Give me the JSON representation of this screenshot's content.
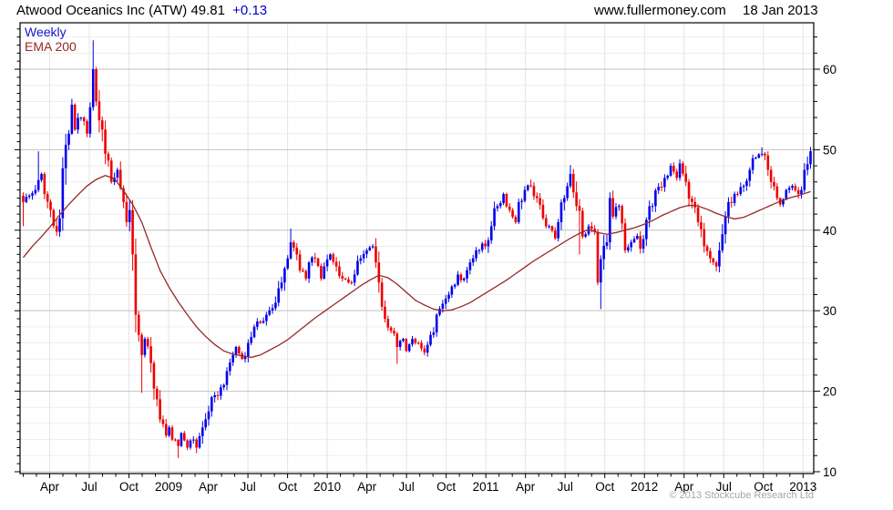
{
  "header": {
    "title": "Atwood Oceanics Inc (ATW)",
    "price": "49.81",
    "change": "+0.13",
    "site": "www.fullermoney.com",
    "date": "18 Jan 2013"
  },
  "legend": {
    "frequency": "Weekly",
    "overlay": "EMA 200"
  },
  "footer": {
    "copyright": "© 2013 Stockcube Research Ltd"
  },
  "colors": {
    "up": "#0000ee",
    "down": "#ee0000",
    "ema": "#962828",
    "accent_blue": "#0000cc",
    "legend_blue": "#1414cc",
    "grid_minor": "#ededed",
    "grid_major": "#c2c2c2",
    "grid_vertical": "#e4e4e4",
    "copyright_gray": "#a6a6a6",
    "axis": "#000000"
  },
  "chart_data": {
    "type": "candlestick",
    "title": "Atwood Oceanics Inc (ATW) weekly with 200 EMA",
    "frequency": "Weekly",
    "overlay": "EMA 200",
    "last_price": 49.81,
    "change": 0.13,
    "x_start": "2008-02",
    "x_end": "2013-01",
    "weeks": 260,
    "y_ticks": [
      10,
      20,
      30,
      40,
      50,
      60
    ],
    "y_minor_step": 2,
    "y_range": [
      9.77,
      65.77
    ],
    "x_tick_labels": [
      "Apr",
      "Jul",
      "Oct",
      "2009",
      "Apr",
      "Jul",
      "Oct",
      "2010",
      "Apr",
      "Jul",
      "Oct",
      "2011",
      "Apr",
      "Jul",
      "Oct",
      "2012",
      "Apr",
      "Jul",
      "Oct",
      "2013"
    ],
    "layout": {
      "l": 22,
      "t": 25,
      "r": 893,
      "b": 520
    },
    "close_anchors": [
      [
        0,
        43.5
      ],
      [
        2,
        44.3
      ],
      [
        4,
        45.0
      ],
      [
        6,
        47.0
      ],
      [
        7,
        44.5
      ],
      [
        9,
        42.5
      ],
      [
        11,
        39.8
      ],
      [
        12,
        41.5
      ],
      [
        13,
        47.7
      ],
      [
        15,
        52.0
      ],
      [
        16,
        55.6
      ],
      [
        17,
        52.5
      ],
      [
        19,
        54.0
      ],
      [
        21,
        52.0
      ],
      [
        23,
        60.0
      ],
      [
        24,
        56.0
      ],
      [
        26,
        52.5
      ],
      [
        27,
        49.5
      ],
      [
        29,
        46.0
      ],
      [
        31,
        47.5
      ],
      [
        33,
        43.5
      ],
      [
        34,
        41.0
      ],
      [
        35,
        42.5
      ],
      [
        36,
        37.0
      ],
      [
        37,
        29.5
      ],
      [
        38,
        27.0
      ],
      [
        39,
        24.5
      ],
      [
        40,
        26.5
      ],
      [
        42,
        23.5
      ],
      [
        44,
        19.0
      ],
      [
        45,
        16.5
      ],
      [
        47,
        14.5
      ],
      [
        48,
        15.5
      ],
      [
        49,
        14.0
      ],
      [
        51,
        13.2
      ],
      [
        52,
        14.8
      ],
      [
        54,
        13.0
      ],
      [
        56,
        14.0
      ],
      [
        57,
        13.0
      ],
      [
        59,
        15.5
      ],
      [
        61,
        17.5
      ],
      [
        63,
        19.5
      ],
      [
        65,
        20.5
      ],
      [
        67,
        22.5
      ],
      [
        69,
        24.5
      ],
      [
        70,
        25.5
      ],
      [
        72,
        24.0
      ],
      [
        74,
        26.0
      ],
      [
        76,
        28.0
      ],
      [
        78,
        28.5
      ],
      [
        80,
        29.5
      ],
      [
        83,
        31.0
      ],
      [
        85,
        33.5
      ],
      [
        87,
        36.5
      ],
      [
        88,
        38.5
      ],
      [
        90,
        37.0
      ],
      [
        91,
        35.0
      ],
      [
        93,
        34.0
      ],
      [
        94,
        36.0
      ],
      [
        96,
        36.5
      ],
      [
        98,
        34.0
      ],
      [
        99,
        35.5
      ],
      [
        101,
        37.0
      ],
      [
        103,
        35.5
      ],
      [
        105,
        34.0
      ],
      [
        107,
        33.5
      ],
      [
        109,
        34.5
      ],
      [
        111,
        36.5
      ],
      [
        113,
        37.5
      ],
      [
        115,
        38.0
      ],
      [
        116,
        36.0
      ],
      [
        117,
        33.5
      ],
      [
        118,
        30.5
      ],
      [
        119,
        29.0
      ],
      [
        121,
        27.5
      ],
      [
        123,
        25.5
      ],
      [
        125,
        26.5
      ],
      [
        126,
        25.0
      ],
      [
        128,
        26.5
      ],
      [
        130,
        26.0
      ],
      [
        132,
        24.8
      ],
      [
        134,
        27.0
      ],
      [
        136,
        29.5
      ],
      [
        139,
        31.5
      ],
      [
        141,
        33.0
      ],
      [
        143,
        34.5
      ],
      [
        145,
        34.0
      ],
      [
        147,
        36.0
      ],
      [
        149,
        37.5
      ],
      [
        152,
        38.0
      ],
      [
        154,
        40.5
      ],
      [
        156,
        43.0
      ],
      [
        158,
        44.5
      ],
      [
        160,
        42.5
      ],
      [
        162,
        41.0
      ],
      [
        163,
        43.5
      ],
      [
        165,
        45.0
      ],
      [
        167,
        45.5
      ],
      [
        169,
        44.0
      ],
      [
        171,
        41.5
      ],
      [
        173,
        40.5
      ],
      [
        175,
        39.0
      ],
      [
        176,
        41.0
      ],
      [
        178,
        44.0
      ],
      [
        180,
        47.0
      ],
      [
        181,
        44.7
      ],
      [
        183,
        42.4
      ],
      [
        184,
        39.2
      ],
      [
        186,
        40.5
      ],
      [
        188,
        39.8
      ],
      [
        189,
        33.5
      ],
      [
        190,
        36.4
      ],
      [
        192,
        38.5
      ],
      [
        193,
        44.0
      ],
      [
        194,
        41.7
      ],
      [
        196,
        43.0
      ],
      [
        198,
        37.5
      ],
      [
        200,
        38.5
      ],
      [
        202,
        39.3
      ],
      [
        203,
        37.7
      ],
      [
        205,
        41.3
      ],
      [
        207,
        43.0
      ],
      [
        209,
        45.4
      ],
      [
        211,
        46.5
      ],
      [
        213,
        48.0
      ],
      [
        215,
        46.5
      ],
      [
        216,
        48.3
      ],
      [
        218,
        46.0
      ],
      [
        220,
        43.5
      ],
      [
        222,
        41.0
      ],
      [
        224,
        38.0
      ],
      [
        226,
        36.5
      ],
      [
        228,
        35.5
      ],
      [
        229,
        37.5
      ],
      [
        230,
        39.5
      ],
      [
        232,
        43.5
      ],
      [
        235,
        44.5
      ],
      [
        237,
        45.5
      ],
      [
        239,
        47.5
      ],
      [
        241,
        49.0
      ],
      [
        243,
        49.5
      ],
      [
        245,
        47.5
      ],
      [
        246,
        46.0
      ],
      [
        248,
        44.0
      ],
      [
        249,
        43.2
      ],
      [
        251,
        45.0
      ],
      [
        253,
        45.5
      ],
      [
        255,
        44.5
      ],
      [
        256,
        45.0
      ],
      [
        257,
        47.5
      ],
      [
        258,
        48.2
      ],
      [
        259,
        49.81
      ]
    ],
    "ema_anchors": [
      [
        0,
        36.6
      ],
      [
        3,
        38.0
      ],
      [
        6,
        39.2
      ],
      [
        9,
        40.5
      ],
      [
        12,
        41.9
      ],
      [
        15,
        43.2
      ],
      [
        18,
        44.4
      ],
      [
        21,
        45.5
      ],
      [
        24,
        46.3
      ],
      [
        27,
        46.8
      ],
      [
        30,
        46.4
      ],
      [
        33,
        44.9
      ],
      [
        36,
        43.2
      ],
      [
        39,
        41.0
      ],
      [
        42,
        37.9
      ],
      [
        45,
        35.0
      ],
      [
        48,
        32.9
      ],
      [
        51,
        31.1
      ],
      [
        54,
        29.5
      ],
      [
        57,
        28.0
      ],
      [
        60,
        26.8
      ],
      [
        63,
        25.8
      ],
      [
        66,
        25.0
      ],
      [
        69,
        24.6
      ],
      [
        72,
        24.4
      ],
      [
        75,
        24.2
      ],
      [
        78,
        24.5
      ],
      [
        81,
        25.1
      ],
      [
        84,
        25.7
      ],
      [
        87,
        26.4
      ],
      [
        90,
        27.3
      ],
      [
        93,
        28.2
      ],
      [
        96,
        29.1
      ],
      [
        99,
        29.9
      ],
      [
        102,
        30.7
      ],
      [
        105,
        31.5
      ],
      [
        108,
        32.3
      ],
      [
        111,
        33.1
      ],
      [
        114,
        33.8
      ],
      [
        117,
        34.4
      ],
      [
        120,
        34.1
      ],
      [
        123,
        33.3
      ],
      [
        126,
        32.3
      ],
      [
        129,
        31.3
      ],
      [
        132,
        30.7
      ],
      [
        135,
        30.2
      ],
      [
        138,
        30.0
      ],
      [
        141,
        30.1
      ],
      [
        144,
        30.5
      ],
      [
        147,
        31.0
      ],
      [
        150,
        31.7
      ],
      [
        153,
        32.4
      ],
      [
        156,
        33.1
      ],
      [
        159,
        33.8
      ],
      [
        162,
        34.6
      ],
      [
        165,
        35.4
      ],
      [
        168,
        36.2
      ],
      [
        171,
        36.9
      ],
      [
        174,
        37.6
      ],
      [
        177,
        38.3
      ],
      [
        180,
        39.0
      ],
      [
        183,
        39.6
      ],
      [
        186,
        40.1
      ],
      [
        189,
        39.7
      ],
      [
        192,
        39.5
      ],
      [
        195,
        39.7
      ],
      [
        198,
        40.0
      ],
      [
        201,
        40.3
      ],
      [
        204,
        40.7
      ],
      [
        207,
        41.2
      ],
      [
        210,
        41.8
      ],
      [
        213,
        42.3
      ],
      [
        216,
        42.8
      ],
      [
        219,
        43.1
      ],
      [
        222,
        43.0
      ],
      [
        225,
        42.6
      ],
      [
        228,
        42.1
      ],
      [
        231,
        41.7
      ],
      [
        234,
        41.4
      ],
      [
        237,
        41.6
      ],
      [
        240,
        42.1
      ],
      [
        243,
        42.6
      ],
      [
        246,
        43.1
      ],
      [
        249,
        43.6
      ],
      [
        252,
        44.0
      ],
      [
        255,
        44.3
      ],
      [
        259,
        44.8
      ]
    ],
    "wick_extremes": [
      [
        0,
        "lo",
        40.5
      ],
      [
        5,
        "hi",
        49.8
      ],
      [
        11,
        "lo",
        39.3
      ],
      [
        23,
        "hi",
        63.6
      ],
      [
        39,
        "lo",
        19.8
      ],
      [
        51,
        "lo",
        11.7
      ],
      [
        57,
        "lo",
        12.3
      ],
      [
        88,
        "hi",
        40.2
      ],
      [
        123,
        "lo",
        23.4
      ],
      [
        167,
        "hi",
        46.3
      ],
      [
        180,
        "hi",
        48.1
      ],
      [
        183,
        "lo",
        37.0
      ],
      [
        190,
        "lo",
        30.2
      ],
      [
        216,
        "hi",
        48.8
      ],
      [
        228,
        "lo",
        34.9
      ],
      [
        243,
        "hi",
        50.3
      ]
    ]
  }
}
